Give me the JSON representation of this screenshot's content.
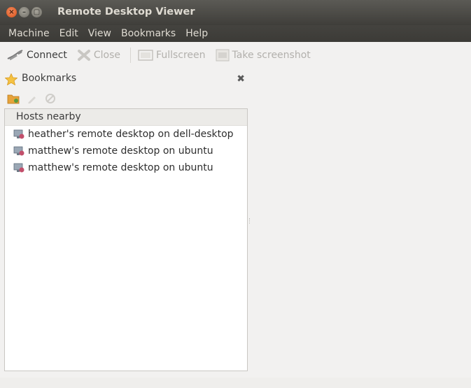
{
  "window": {
    "title": "Remote Desktop Viewer",
    "controls": {
      "close": "×",
      "minimize": "–",
      "maximize": "▢"
    }
  },
  "menubar": {
    "items": [
      "Machine",
      "Edit",
      "View",
      "Bookmarks",
      "Help"
    ]
  },
  "toolbar": {
    "connect_label": "Connect",
    "close_label": "Close",
    "fullscreen_label": "Fullscreen",
    "screenshot_label": "Take screenshot"
  },
  "bookmarks": {
    "title": "Bookmarks",
    "close_glyph": "✖",
    "list_header": "Hosts nearby",
    "hosts": [
      "heather's remote desktop on dell-desktop",
      "matthew's remote desktop on ubuntu",
      "matthew's remote desktop on ubuntu"
    ]
  }
}
